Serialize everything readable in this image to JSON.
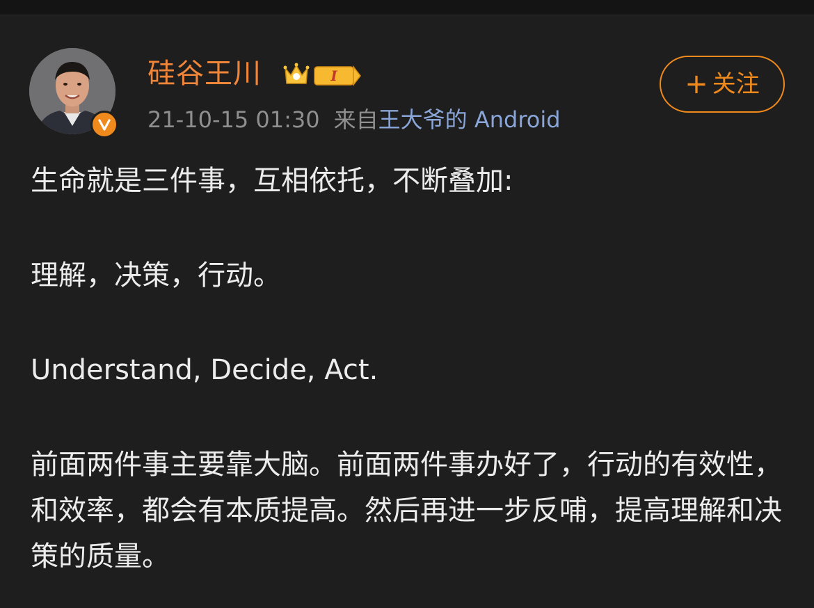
{
  "post": {
    "author": {
      "name": "硅谷王川",
      "vip_level": "I",
      "verified": true,
      "avatar_icon": "avatar-photo"
    },
    "meta": {
      "timestamp": "21-10-15 01:30",
      "source_prefix": "来自",
      "source_device": "王大爷的 Android"
    },
    "follow_button": {
      "plus": "+",
      "label": "关注"
    },
    "paragraphs": [
      "生命就是三件事，互相依托，不断叠加:",
      "理解，决策，行动。",
      "Understand, Decide, Act.",
      "前面两件事主要靠大脑。前面两件事办好了，行动的有效性，和效率，都会有本质提高。然后再进一步反哺，提高理解和决策的质量。"
    ]
  },
  "colors": {
    "background": "#1e1e1e",
    "accent": "#f08a1c",
    "username": "#f0863a",
    "meta_text": "#8f8f8f",
    "device_link": "#8aa6d8",
    "body_text": "#ececec"
  }
}
